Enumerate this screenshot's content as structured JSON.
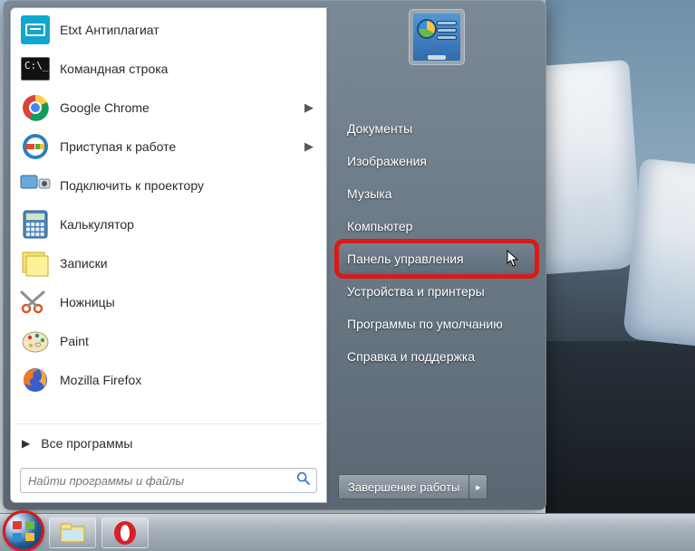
{
  "left_programs": [
    {
      "label": "Etxt Антиплагиат",
      "icon": "etxt",
      "has_submenu": false
    },
    {
      "label": "Командная строка",
      "icon": "cmd",
      "has_submenu": false
    },
    {
      "label": "Google Chrome",
      "icon": "chrome",
      "has_submenu": true
    },
    {
      "label": "Приступая к работе",
      "icon": "getting-started",
      "has_submenu": true
    },
    {
      "label": "Подключить к проектору",
      "icon": "projector",
      "has_submenu": false
    },
    {
      "label": "Калькулятор",
      "icon": "calculator",
      "has_submenu": false
    },
    {
      "label": "Записки",
      "icon": "sticky-notes",
      "has_submenu": false
    },
    {
      "label": "Ножницы",
      "icon": "snipping-tool",
      "has_submenu": false
    },
    {
      "label": "Paint",
      "icon": "paint",
      "has_submenu": false
    },
    {
      "label": "Mozilla Firefox",
      "icon": "firefox",
      "has_submenu": false
    }
  ],
  "all_programs_label": "Все программы",
  "search_placeholder": "Найти программы и файлы",
  "right_items": [
    {
      "label": "Документы",
      "highlighted": false
    },
    {
      "label": "Изображения",
      "highlighted": false
    },
    {
      "label": "Музыка",
      "highlighted": false
    },
    {
      "label": "Компьютер",
      "highlighted": false
    },
    {
      "label": "Панель управления",
      "highlighted": true
    },
    {
      "label": "Устройства и принтеры",
      "highlighted": false
    },
    {
      "label": "Программы по умолчанию",
      "highlighted": false
    },
    {
      "label": "Справка и поддержка",
      "highlighted": false
    }
  ],
  "shutdown_label": "Завершение работы",
  "taskbar_items": [
    {
      "name": "explorer"
    },
    {
      "name": "opera"
    }
  ]
}
